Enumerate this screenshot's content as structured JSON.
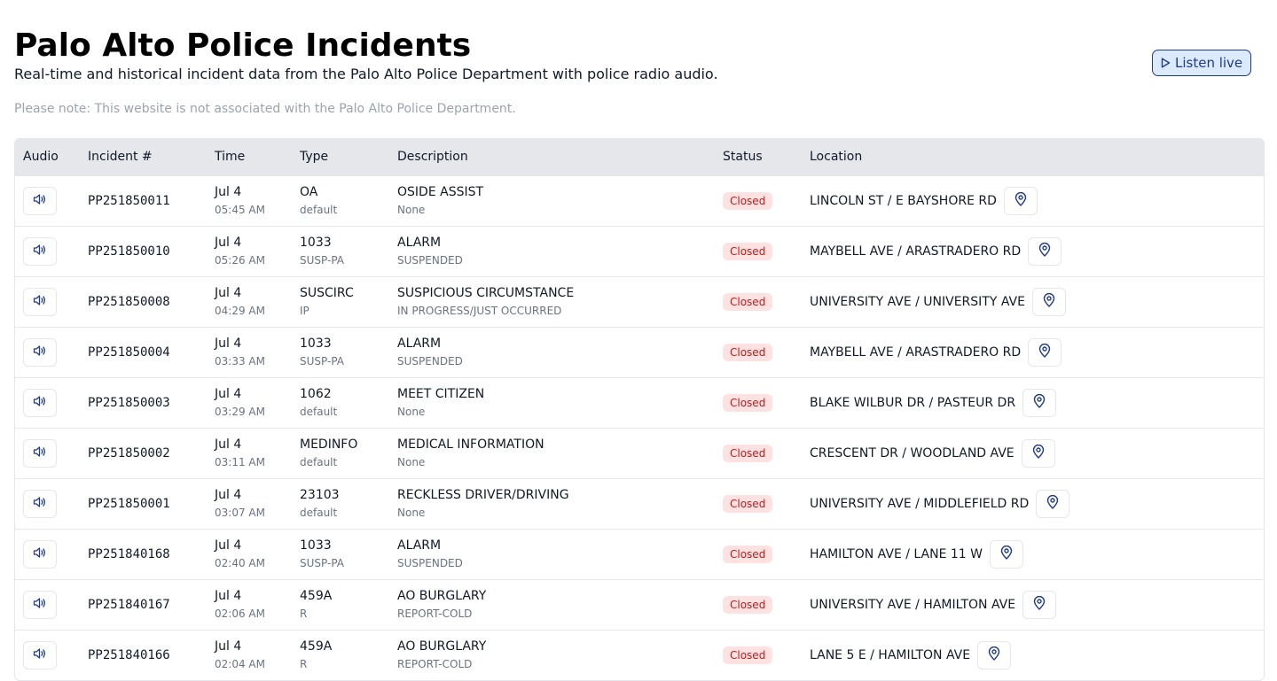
{
  "header": {
    "title": "Palo Alto Police Incidents",
    "subtitle": "Real-time and historical incident data from the Palo Alto Police Department with police radio audio.",
    "disclaimer": "Please note: This website is not associated with the Palo Alto Police Department.",
    "listen_label": "Listen live"
  },
  "table": {
    "columns": [
      "Audio",
      "Incident #",
      "Time",
      "Type",
      "Description",
      "Status",
      "Location"
    ],
    "rows": [
      {
        "incident": "PP251850011",
        "date": "Jul 4",
        "time": "05:45 AM",
        "type": "OA",
        "type_sub": "default",
        "desc": "OSIDE ASSIST",
        "desc_sub": "None",
        "status": "Closed",
        "location": "LINCOLN ST / E BAYSHORE RD"
      },
      {
        "incident": "PP251850010",
        "date": "Jul 4",
        "time": "05:26 AM",
        "type": "1033",
        "type_sub": "SUSP-PA",
        "desc": "ALARM",
        "desc_sub": "SUSPENDED",
        "status": "Closed",
        "location": "MAYBELL AVE / ARASTRADERO RD"
      },
      {
        "incident": "PP251850008",
        "date": "Jul 4",
        "time": "04:29 AM",
        "type": "SUSCIRC",
        "type_sub": "IP",
        "desc": "SUSPICIOUS CIRCUMSTANCE",
        "desc_sub": "IN PROGRESS/JUST OCCURRED",
        "status": "Closed",
        "location": "UNIVERSITY AVE / UNIVERSITY AVE"
      },
      {
        "incident": "PP251850004",
        "date": "Jul 4",
        "time": "03:33 AM",
        "type": "1033",
        "type_sub": "SUSP-PA",
        "desc": "ALARM",
        "desc_sub": "SUSPENDED",
        "status": "Closed",
        "location": "MAYBELL AVE / ARASTRADERO RD"
      },
      {
        "incident": "PP251850003",
        "date": "Jul 4",
        "time": "03:29 AM",
        "type": "1062",
        "type_sub": "default",
        "desc": "MEET CITIZEN",
        "desc_sub": "None",
        "status": "Closed",
        "location": "BLAKE WILBUR DR / PASTEUR DR"
      },
      {
        "incident": "PP251850002",
        "date": "Jul 4",
        "time": "03:11 AM",
        "type": "MEDINFO",
        "type_sub": "default",
        "desc": "MEDICAL INFORMATION",
        "desc_sub": "None",
        "status": "Closed",
        "location": "CRESCENT DR / WOODLAND AVE"
      },
      {
        "incident": "PP251850001",
        "date": "Jul 4",
        "time": "03:07 AM",
        "type": "23103",
        "type_sub": "default",
        "desc": "RECKLESS DRIVER/DRIVING",
        "desc_sub": "None",
        "status": "Closed",
        "location": "UNIVERSITY AVE / MIDDLEFIELD RD"
      },
      {
        "incident": "PP251840168",
        "date": "Jul 4",
        "time": "02:40 AM",
        "type": "1033",
        "type_sub": "SUSP-PA",
        "desc": "ALARM",
        "desc_sub": "SUSPENDED",
        "status": "Closed",
        "location": "HAMILTON AVE / LANE 11 W"
      },
      {
        "incident": "PP251840167",
        "date": "Jul 4",
        "time": "02:06 AM",
        "type": "459A",
        "type_sub": "R",
        "desc": "AO BURGLARY",
        "desc_sub": "REPORT-COLD",
        "status": "Closed",
        "location": "UNIVERSITY AVE / HAMILTON AVE"
      },
      {
        "incident": "PP251840166",
        "date": "Jul 4",
        "time": "02:04 AM",
        "type": "459A",
        "type_sub": "R",
        "desc": "AO BURGLARY",
        "desc_sub": "REPORT-COLD",
        "status": "Closed",
        "location": "LANE 5 E / HAMILTON AVE"
      }
    ]
  },
  "icons": {
    "audio": "speaker-icon",
    "map": "map-pin-icon",
    "listen": "play-icon"
  },
  "colors": {
    "accent": "#1e3a8a",
    "status_closed_bg": "#fee2e2",
    "status_closed_text": "#b91c1c",
    "header_bg": "#e5e7eb"
  }
}
